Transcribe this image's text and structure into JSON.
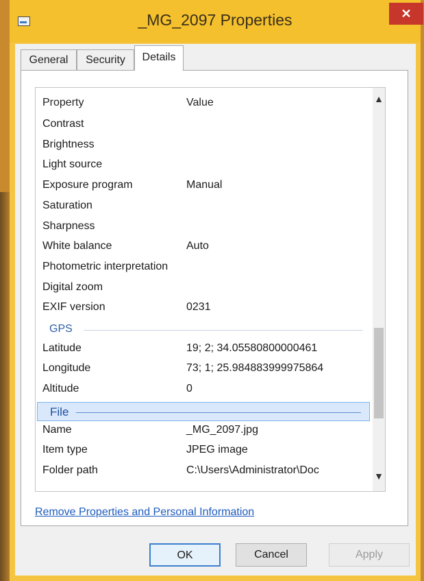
{
  "window": {
    "title": "_MG_2097 Properties",
    "close_label": "✕"
  },
  "tabs": [
    {
      "label": "General",
      "active": false
    },
    {
      "label": "Security",
      "active": false
    },
    {
      "label": "Details",
      "active": true
    }
  ],
  "details": {
    "columns": [
      "Property",
      "Value"
    ],
    "rows": [
      {
        "type": "row",
        "property": "Contrast",
        "value": ""
      },
      {
        "type": "row",
        "property": "Brightness",
        "value": ""
      },
      {
        "type": "row",
        "property": "Light source",
        "value": ""
      },
      {
        "type": "row",
        "property": "Exposure program",
        "value": "Manual"
      },
      {
        "type": "row",
        "property": "Saturation",
        "value": ""
      },
      {
        "type": "row",
        "property": "Sharpness",
        "value": ""
      },
      {
        "type": "row",
        "property": "White balance",
        "value": "Auto"
      },
      {
        "type": "row",
        "property": "Photometric interpretation",
        "value": ""
      },
      {
        "type": "row",
        "property": "Digital zoom",
        "value": ""
      },
      {
        "type": "row",
        "property": "EXIF version",
        "value": "0231"
      },
      {
        "type": "group",
        "label": "GPS",
        "selected": false
      },
      {
        "type": "row",
        "property": "Latitude",
        "value": "19; 2; 34.05580800000461"
      },
      {
        "type": "row",
        "property": "Longitude",
        "value": "73; 1; 25.984883999975864"
      },
      {
        "type": "row",
        "property": "Altitude",
        "value": "0"
      },
      {
        "type": "group",
        "label": "File",
        "selected": true
      },
      {
        "type": "row",
        "property": "Name",
        "value": "_MG_2097.jpg"
      },
      {
        "type": "row",
        "property": "Item type",
        "value": "JPEG image"
      },
      {
        "type": "row",
        "property": "Folder path",
        "value": "C:\\Users\\Administrator\\Doc"
      }
    ]
  },
  "link_text": "Remove Properties and Personal Information",
  "buttons": {
    "ok": "OK",
    "cancel": "Cancel",
    "apply": "Apply"
  },
  "icons": {
    "window_icon": "image-file-icon",
    "scroll_up": "chevron-up-icon",
    "scroll_down": "chevron-down-icon"
  },
  "scroll": {
    "thumb_position_fraction": 0.63
  }
}
